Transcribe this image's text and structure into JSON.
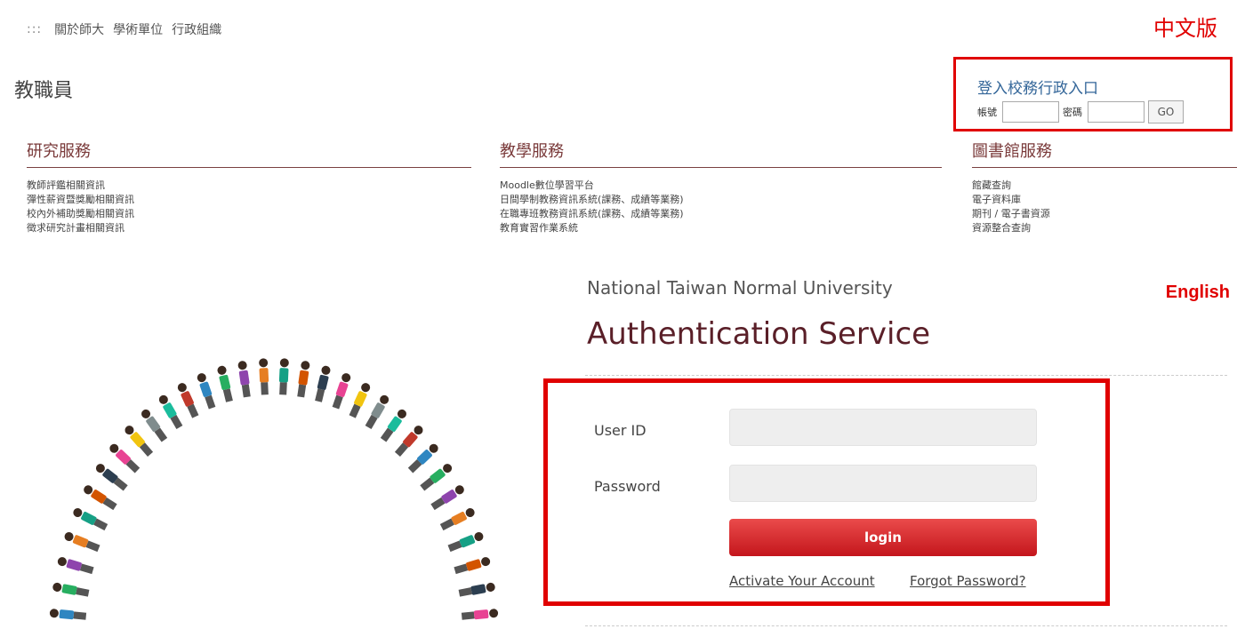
{
  "nav": {
    "dots": ":::",
    "items": [
      "關於師大",
      "學術單位",
      "行政組織"
    ]
  },
  "lang": {
    "zh": "中文版",
    "en": "English"
  },
  "section_title": "教職員",
  "admin_login": {
    "title": "登入校務行政入口",
    "account_label": "帳號",
    "password_label": "密碼",
    "go_label": "GO"
  },
  "services": {
    "research": {
      "title": "研究服務",
      "items": [
        "教師評鑑相關資訊",
        "彈性薪資暨獎勵相關資訊",
        "校內外補助獎勵相關資訊",
        "徵求研究計畫相關資訊"
      ]
    },
    "teaching": {
      "title": "教學服務",
      "items": [
        "Moodle數位學習平台",
        "日間學制教務資訊系統(課務、成績等業務)",
        "在職專班教務資訊系統(課務、成績等業務)",
        "教育實習作業系統"
      ]
    },
    "library": {
      "title": "圖書館服務",
      "items": [
        "館藏查詢",
        "電子資料庫",
        "期刊 / 電子書資源",
        "資源整合查詢"
      ]
    }
  },
  "auth": {
    "university": "National Taiwan Normal University",
    "title": "Authentication Service",
    "user_id_label": "User ID",
    "password_label": "Password",
    "login_label": "login",
    "activate_link": "Activate Your Account",
    "forgot_link": "Forgot Password?"
  },
  "colors": {
    "accent_red": "#e00000",
    "brand_maroon": "#5a1f28",
    "link_blue": "#336699"
  }
}
